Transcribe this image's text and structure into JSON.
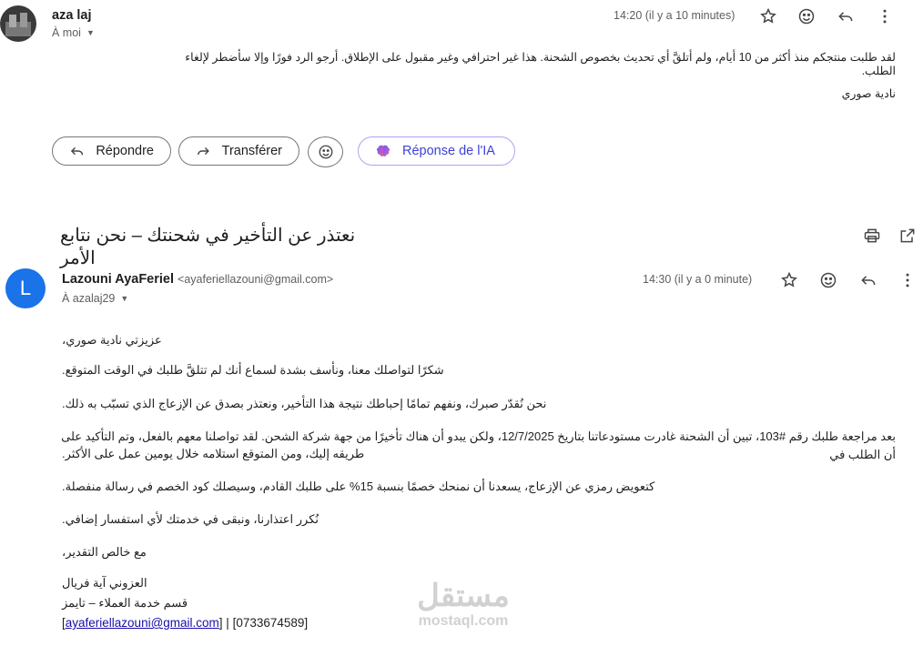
{
  "first_message": {
    "sender": "aza laj",
    "recipient": "À moi",
    "time": "14:20 (il y a 10 minutes)",
    "body_line1": "لقد طلبت منتجكم منذ أكثر من 10 أيام، ولم أتلقَّ أي تحديث بخصوص الشحنة. هذا غير احترافي وغير مقبول على الإطلاق. أرجو الرد فورًا وإلا سأضطر لإلغاء الطلب.",
    "body_line2": "نادية صوري"
  },
  "actions": {
    "reply_label": "Répondre",
    "forward_label": "Transférer",
    "ai_label": "Réponse de l'IA"
  },
  "subject": "نعتذر عن التأخير في شحنتك – نحن نتابع الأمر",
  "second_message": {
    "avatar_letter": "L",
    "avatar_color": "#1a73e8",
    "sender_name": "Lazouni AyaFeriel",
    "sender_email": "<ayaferiellazouni@gmail.com>",
    "recipient": "À azalaj29",
    "time": "14:30 (il y a 0 minute)",
    "greeting": "عزيزتي نادية صوري،",
    "p1": "شكرًا لتواصلك معنا، ونأسف بشدة لسماع أنك لم تتلقَّ طلبك في الوقت المتوقع.",
    "p2": "نحن نُقدّر صبرك، ونفهم تمامًا إحباطك نتيجة هذا التأخير، ونعتذر بصدق عن الإزعاج الذي تسبّب به ذلك.",
    "p3_line1": "بعد مراجعة طلبك رقم #103، تبين أن الشحنة غادرت مستودعاتنا بتاريخ 12/7/2025، ولكن يبدو أن هناك تأخيرًا من جهة شركة الشحن. لقد تواصلنا معهم بالفعل، وتم التأكيد على أن الطلب في",
    "p3_line2": "طريقه إليك، ومن المتوقع استلامه خلال يومين عمل على الأكثر.",
    "p4": "كتعويض رمزي عن الإزعاج، يسعدنا أن نمنحك خصمًا بنسبة 15% على طلبك القادم، وسيصلك كود الخصم في رسالة منفصلة.",
    "p5": "نُكرر اعتذارنا، ونبقى في خدمتك لأي استفسار إضافي.",
    "closing": "مع خالص التقدير،",
    "sig_name": "العزوني آية فريال",
    "sig_dept": "قسم خدمة العملاء – تايمز",
    "sig_email": "ayaferiellazouni@gmail.com",
    "sig_phone": "[0733674589]"
  },
  "watermark": {
    "brand": "مستقل",
    "site": "mostaql.com"
  }
}
